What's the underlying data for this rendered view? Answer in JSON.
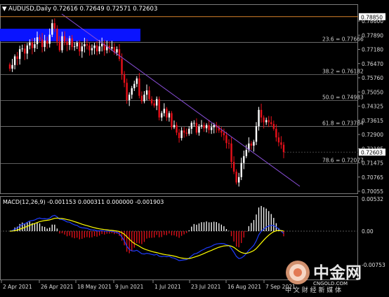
{
  "header": {
    "symbol_line": "AUDUSD,Daily  0.72616 0.72649 0.72571 0.72603",
    "collapse_glyph": "▼"
  },
  "macd_header": "MACD(12,26,9) -0.001153 0.000311 0.000000 -0.001903",
  "price_axis": {
    "top_label": "0.78850",
    "current_label": "0.72603",
    "labels": [
      "0.78600",
      "0.77890",
      "0.77180",
      "0.76470",
      "0.75760",
      "0.75050",
      "0.74325",
      "0.73615",
      "0.72900",
      "0.72185",
      "0.71475",
      "0.70765",
      "0.70055"
    ]
  },
  "macd_axis": {
    "labels": [
      "0.00532",
      "0.00",
      "-0.00753"
    ]
  },
  "fib_levels": [
    {
      "label": "23.6 = 0.77666",
      "value": 0.77666
    },
    {
      "label": "38.2 = 0.76182",
      "value": 0.76182
    },
    {
      "label": "50.0 = 0.74983",
      "value": 0.74983
    },
    {
      "label": "61.8 = 0.73784",
      "value": 0.73784
    },
    {
      "label": "78.6 = 0.72077",
      "value": 0.72077
    }
  ],
  "top_line": {
    "value": 0.7885
  },
  "x_axis": {
    "labels": [
      "2 Apr 2021",
      "26 Apr 2021",
      "18 May 2021",
      "9 Jun 2021",
      "1 Jul 2021",
      "23 Jul 2021",
      "16 Aug 2021",
      "7 Sep 2021"
    ]
  },
  "watermark": {
    "logo_text": "中金网",
    "url_text": "CNGOLD.COM",
    "slogan": "中 文 财 经 新 媒 体"
  },
  "colors": {
    "bull": "#ffffff",
    "bear": "#e8101a",
    "fib": "#7a7a7a",
    "trendline": "#8a4fd9",
    "zone": "#0000ff",
    "macd_signal": "#ffff00",
    "macd_line": "#1e3cff",
    "axis_text": "#dcdcdc",
    "top_line": "#d9822b"
  },
  "chart_data": {
    "type": "candlestick",
    "title": "AUDUSD,Daily",
    "ylim": [
      0.7055,
      0.7905
    ],
    "x": [
      "2 Apr 2021",
      "26 Apr 2021",
      "18 May 2021",
      "9 Jun 2021",
      "1 Jul 2021",
      "23 Jul 2021",
      "16 Aug 2021",
      "7 Sep 2021"
    ],
    "close_series": [
      0.7645,
      0.7662,
      0.7702,
      0.769,
      0.7735,
      0.7738,
      0.7715,
      0.7752,
      0.7765,
      0.774,
      0.7758,
      0.779,
      0.778,
      0.7745,
      0.7775,
      0.776,
      0.7802,
      0.7855,
      0.783,
      0.777,
      0.773,
      0.7795,
      0.777,
      0.7755,
      0.7785,
      0.7745,
      0.7748,
      0.7765,
      0.7725,
      0.7748,
      0.7758,
      0.7752,
      0.773,
      0.774,
      0.7752,
      0.7725,
      0.7748,
      0.776,
      0.773,
      0.775,
      0.7738,
      0.7745,
      0.772,
      0.7735,
      0.769,
      0.762,
      0.758,
      0.75,
      0.7525,
      0.7555,
      0.7575,
      0.76,
      0.752,
      0.7495,
      0.7525,
      0.7545,
      0.7505,
      0.7485,
      0.7475,
      0.7505,
      0.742,
      0.744,
      0.746,
      0.742,
      0.744,
      0.7375,
      0.7385,
      0.735,
      0.7325,
      0.736,
      0.735,
      0.7345,
      0.7368,
      0.7395,
      0.7395,
      0.735,
      0.7378,
      0.7385,
      0.737,
      0.7385,
      0.7362,
      0.7375,
      0.7385,
      0.7375,
      0.736,
      0.735,
      0.7338,
      0.7302,
      0.73,
      0.7215,
      0.717,
      0.712,
      0.7145,
      0.721,
      0.7242,
      0.727,
      0.73,
      0.729,
      0.7308,
      0.738,
      0.7455,
      0.742,
      0.7398,
      0.7408,
      0.7398,
      0.739,
      0.7368,
      0.7328,
      0.7305,
      0.7294,
      0.726
    ]
  }
}
